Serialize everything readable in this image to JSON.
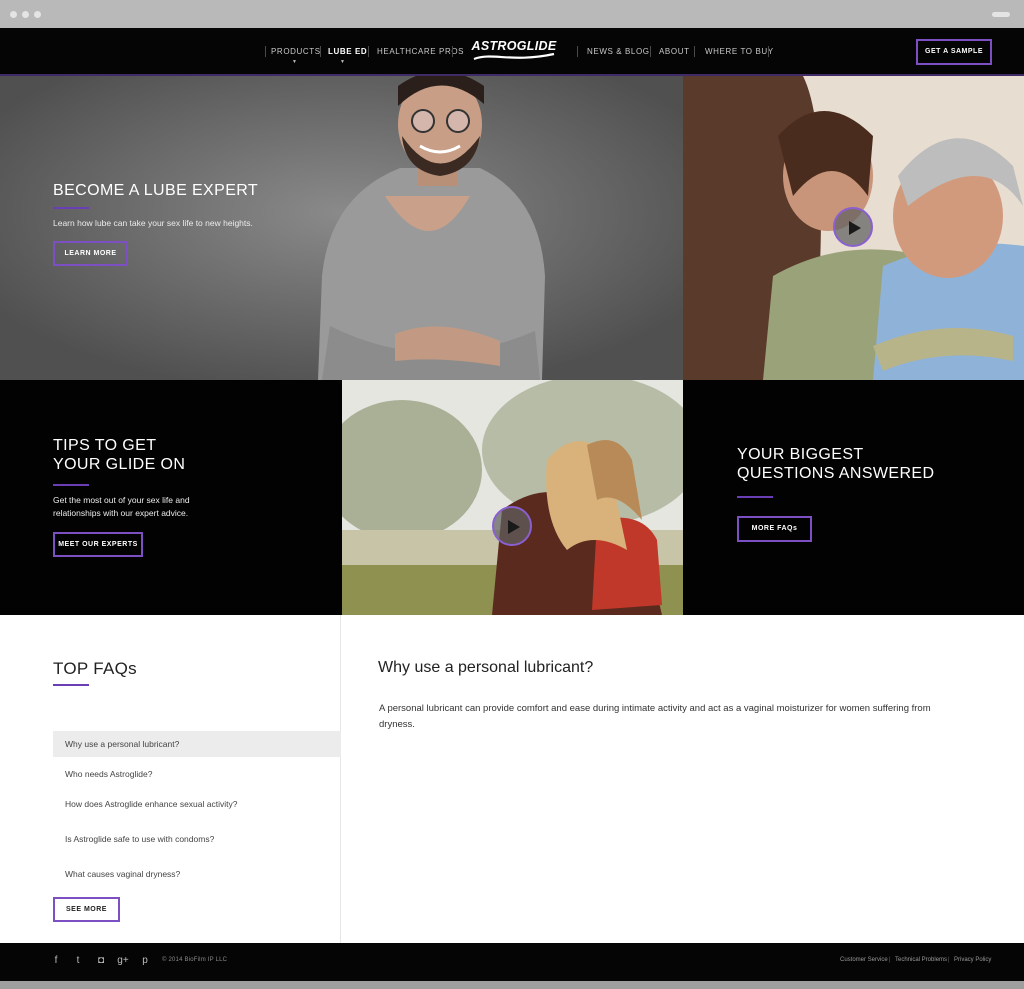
{
  "nav": {
    "items": [
      {
        "label": "PRODUCTS",
        "dropdown": true,
        "active": false
      },
      {
        "label": "LUBE ED",
        "dropdown": true,
        "active": true
      },
      {
        "label": "HEALTHCARE PROS",
        "dropdown": false,
        "active": false
      },
      {
        "label": "NEWS & BLOG",
        "dropdown": false,
        "active": false
      },
      {
        "label": "ABOUT",
        "dropdown": false,
        "active": false
      },
      {
        "label": "WHERE TO BUY",
        "dropdown": false,
        "active": false
      }
    ],
    "logo": "ASTROGLIDE",
    "cta": "GET A SAMPLE",
    "caret": "▼"
  },
  "hero": {
    "title": "BECOME A LUBE EXPERT",
    "text": "Learn how lube can take your sex life to new heights.",
    "button": "LEARN MORE"
  },
  "tips": {
    "title_line1": "TIPS TO GET",
    "title_line2": "YOUR GLIDE ON",
    "text_line1": "Get the most out of your sex life and",
    "text_line2": "relationships with our expert advice.",
    "button": "MEET OUR EXPERTS"
  },
  "questions": {
    "title_line1": "YOUR BIGGEST",
    "title_line2": "QUESTIONS ANSWERED",
    "button": "MORE FAQs"
  },
  "faq": {
    "heading": "TOP FAQs",
    "items": [
      "Why use a personal lubricant?",
      "Who needs Astroglide?",
      "How does Astroglide enhance sexual activity?",
      "Is Astroglide safe to use with condoms?",
      "What causes vaginal dryness?"
    ],
    "selected_index": 0,
    "see_more": "SEE MORE",
    "answer_question": "Why use a personal lubricant?",
    "answer_text": "A personal lubricant can provide comfort and ease during intimate activity and act as a vaginal moisturizer for women suffering from dryness."
  },
  "footer": {
    "social_icons": [
      {
        "name": "facebook-icon",
        "glyph": "f"
      },
      {
        "name": "twitter-icon",
        "glyph": "t"
      },
      {
        "name": "instagram-icon",
        "glyph": "◘"
      },
      {
        "name": "googleplus-icon",
        "glyph": "g+"
      },
      {
        "name": "pinterest-icon",
        "glyph": "p"
      }
    ],
    "copyright": "© 2014 BioFilm IP LLC",
    "links": [
      "Customer Service",
      "Technical Problems",
      "Privacy Policy"
    ],
    "separator": "|"
  },
  "colors": {
    "accent": "#7c4fc3",
    "dark": "#050505",
    "nav_border": "#3f2b66"
  }
}
